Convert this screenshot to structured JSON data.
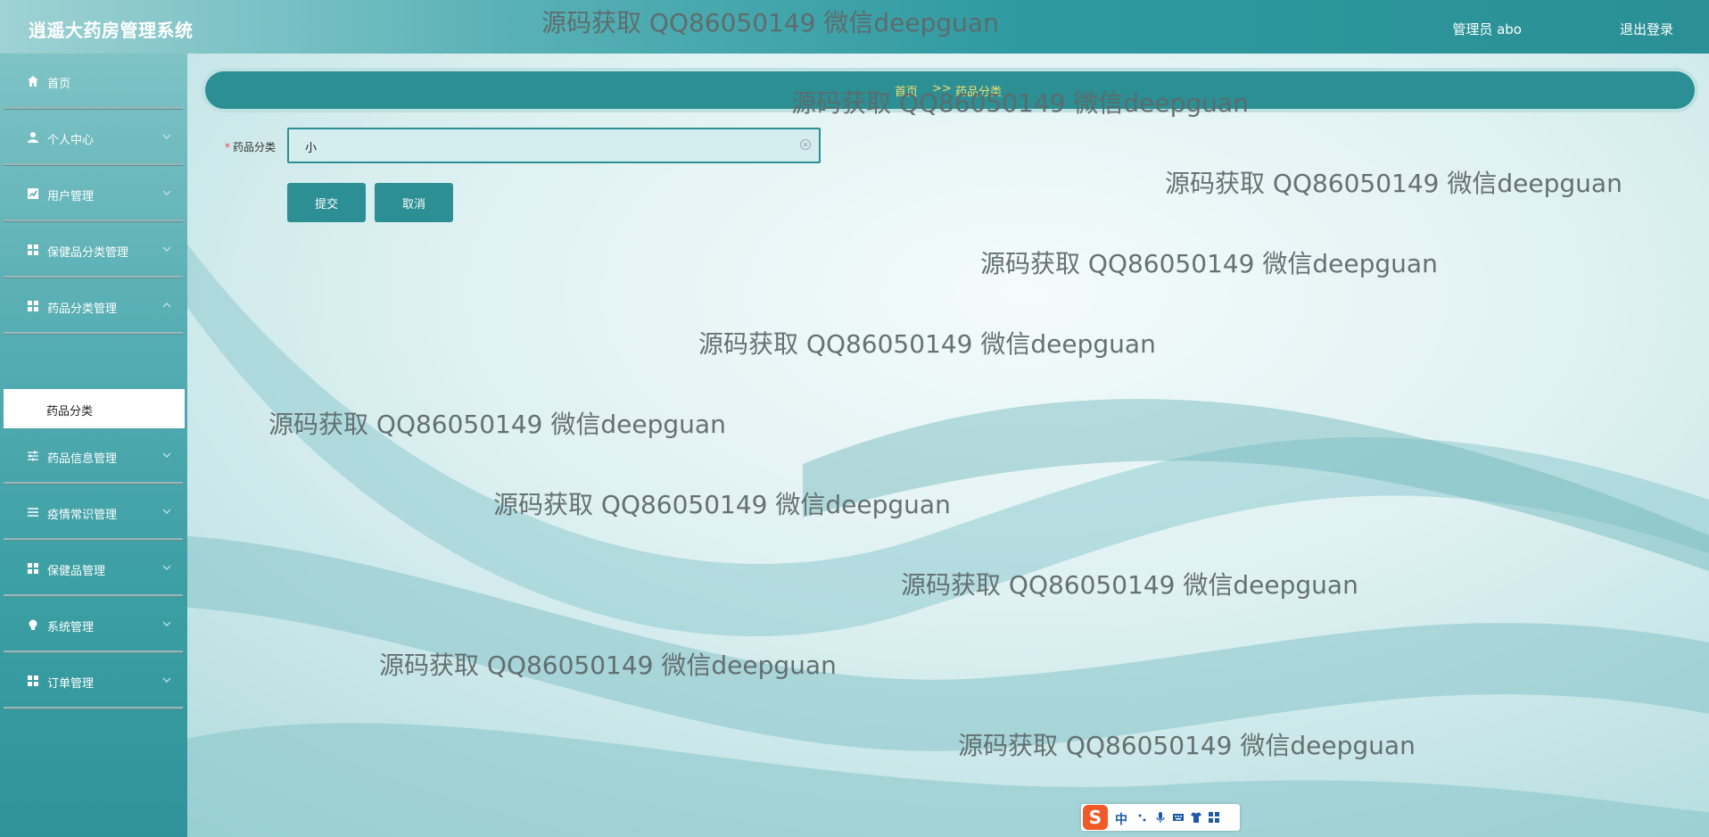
{
  "app": {
    "title": "逍遥大药房管理系统"
  },
  "header": {
    "user_label": "管理员 abo",
    "logout_label": "退出登录"
  },
  "sidebar": {
    "items": [
      {
        "label": "首页",
        "icon": "home-icon",
        "has_chevron": false
      },
      {
        "label": "个人中心",
        "icon": "user-icon",
        "has_chevron": true
      },
      {
        "label": "用户管理",
        "icon": "chart-icon",
        "has_chevron": true
      },
      {
        "label": "保健品分类管理",
        "icon": "grid-icon",
        "has_chevron": true
      },
      {
        "label": "药品分类管理",
        "icon": "grid-icon",
        "has_chevron": true
      },
      {
        "label": "药品信息管理",
        "icon": "sliders-icon",
        "has_chevron": true
      },
      {
        "label": "疫情常识管理",
        "icon": "list-icon",
        "has_chevron": true
      },
      {
        "label": "保健品管理",
        "icon": "grid-icon",
        "has_chevron": true
      },
      {
        "label": "系统管理",
        "icon": "bulb-icon",
        "has_chevron": true
      },
      {
        "label": "订单管理",
        "icon": "grid-icon",
        "has_chevron": true
      }
    ],
    "active_sub": "药品分类"
  },
  "breadcrumb": {
    "home": "首页",
    "separator": ">>",
    "current": "药品分类"
  },
  "form": {
    "label": "药品分类",
    "required_mark": "*",
    "value": "小",
    "submit_label": "提交",
    "cancel_label": "取消"
  },
  "watermark": {
    "text": "源码获取 QQ86050149 微信deepguan"
  },
  "ime": {
    "logo": "S",
    "lang": "中"
  },
  "colors": {
    "accent": "#2c8f93",
    "breadcrumb_text": "#f1e06a",
    "sidebar_top": "#7fc3c6",
    "sidebar_bottom": "#2f9499"
  }
}
